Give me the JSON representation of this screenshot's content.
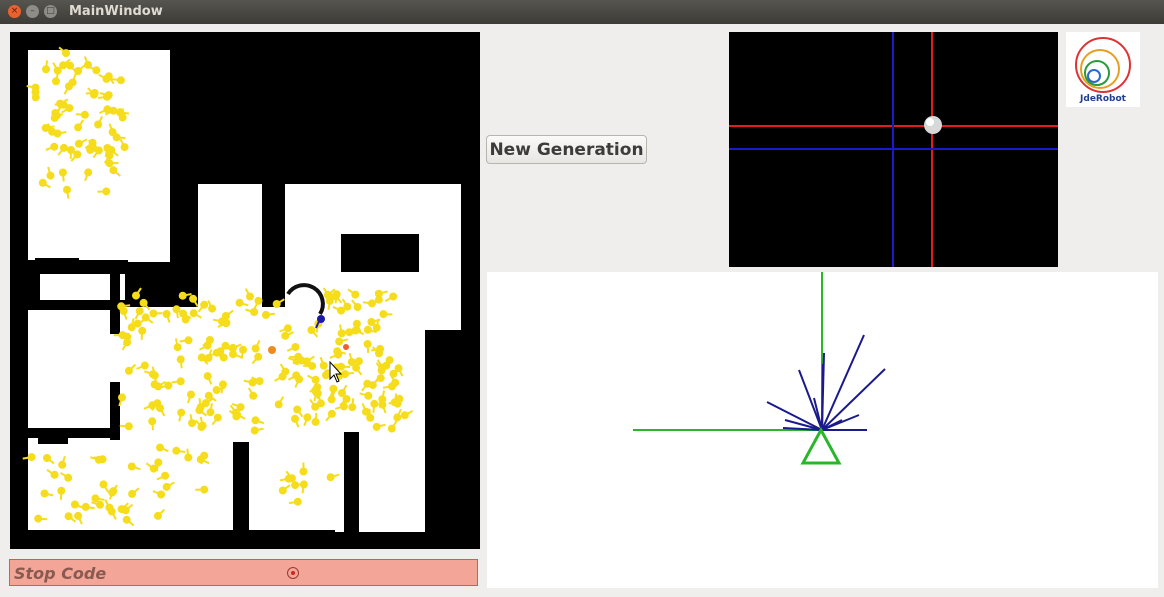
{
  "window": {
    "title": "MainWindow",
    "controls": {
      "close": "×",
      "minimize": "–",
      "maximize": "□"
    }
  },
  "buttons": {
    "new_generation": "New Generation",
    "stop_code": "Stop Code"
  },
  "logo": {
    "text": "JdeRobot"
  },
  "colors": {
    "particle": "#f5dd1c",
    "stop_bar": "#f3a597",
    "robot_arc": "#111111",
    "robot_dot": "#1a1aaa",
    "crosshair_red": "#e11d1d",
    "crosshair_blue": "#1a1ac8",
    "laser_blue": "#1a1a8c",
    "laser_green": "#2bb52b"
  },
  "icons": {
    "close": "close-icon",
    "minimize": "minimize-icon",
    "maximize": "maximize-icon",
    "record": "record-dot-icon",
    "cursor": "mouse-pointer-icon"
  }
}
